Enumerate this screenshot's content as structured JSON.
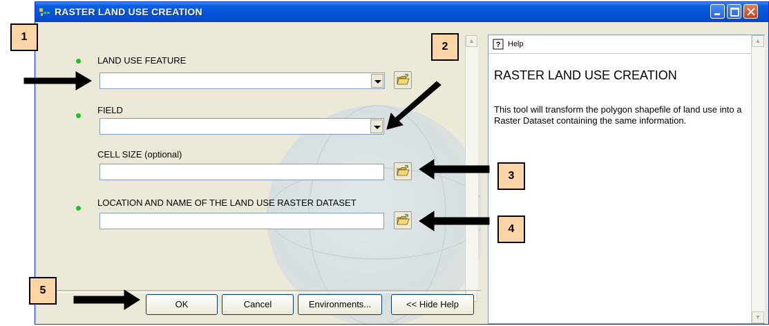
{
  "window": {
    "title": "RASTER LAND USE CREATION"
  },
  "form": {
    "fields": [
      {
        "label": "LAND USE FEATURE",
        "value": "",
        "required": true,
        "control": "combo-with-browse"
      },
      {
        "label": "FIELD",
        "value": "",
        "required": true,
        "control": "combo"
      },
      {
        "label": "CELL SIZE (optional)",
        "value": "",
        "required": false,
        "control": "text-with-browse"
      },
      {
        "label": "LOCATION AND NAME OF THE LAND USE RASTER DATASET",
        "value": "",
        "required": true,
        "control": "text-with-browse"
      }
    ]
  },
  "buttons": {
    "ok": "OK",
    "cancel": "Cancel",
    "environments": "Environments...",
    "hide_help": "<< Hide Help"
  },
  "help": {
    "tab_label": "Help",
    "title": "RASTER LAND USE CREATION",
    "description": "This tool will transform the polygon shapefile of land use into a Raster Dataset containing the same information."
  },
  "annotations": {
    "steps": [
      "1",
      "2",
      "3",
      "4",
      "5"
    ]
  },
  "colors": {
    "title_bar": "#0453d8",
    "required_dot": "#1fc31f",
    "badge_fill": "#fcd5a6",
    "window_face": "#ece9d8"
  },
  "icons": [
    "app-icon",
    "folder-open-icon",
    "help-icon",
    "chevron-down-icon",
    "scroll-up-icon",
    "scroll-down-icon"
  ]
}
